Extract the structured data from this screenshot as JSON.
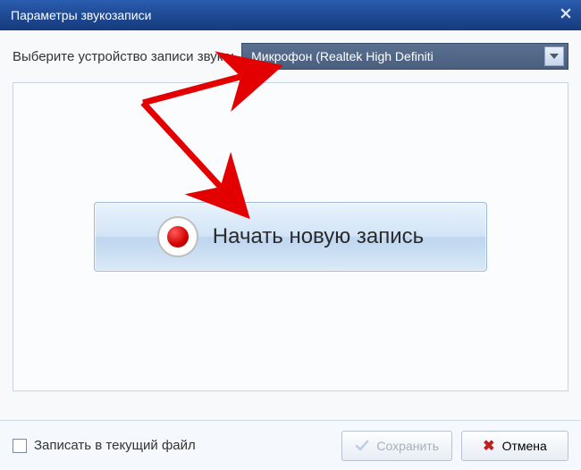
{
  "titlebar": {
    "title": "Параметры звукозаписи"
  },
  "device": {
    "label": "Выберите устройство записи звука:",
    "selected": "Микрофон (Realtek High Definiti"
  },
  "record": {
    "label": "Начать новую запись"
  },
  "footer": {
    "checkbox_label": "Записать в текущий файл",
    "save_label": "Сохранить",
    "cancel_label": "Отмена"
  },
  "colors": {
    "titlebar": "#1f4a94",
    "dropdown_bg": "#4a5f7e",
    "record_red": "#d10000",
    "cancel_red": "#c02020",
    "arrow_annotation": "#e30000"
  }
}
